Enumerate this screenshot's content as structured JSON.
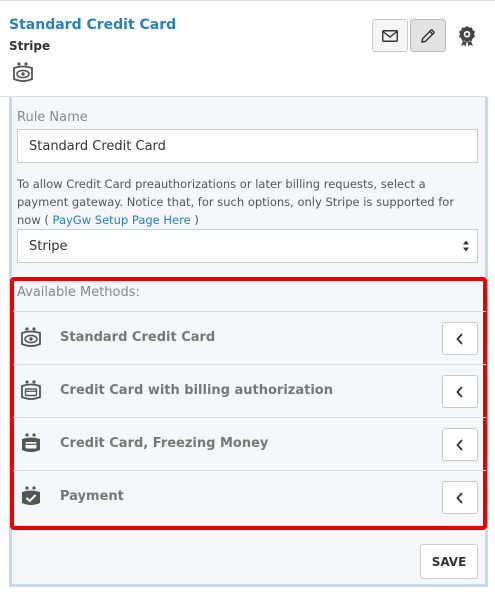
{
  "header": {
    "title": "Standard Credit Card",
    "subtitle": "Stripe",
    "icon": "eye-wallet-icon",
    "mail_icon": "envelope-icon",
    "edit_icon": "pencil-icon",
    "badge_icon": "award-badge-icon"
  },
  "form": {
    "rule_name_label": "Rule Name",
    "rule_name_value": "Standard Credit Card",
    "help_text": "To allow Credit Card preauthorizations or later billing requests, select a payment gateway. Notice that, for such options, only Stripe is supported for now ( ",
    "help_link": "PayGw Setup Page Here",
    "help_text_end": " )",
    "gateway_selected": "Stripe"
  },
  "methods": {
    "title": "Available Methods:",
    "items": [
      {
        "label": "Standard Credit Card",
        "icon": "eye-wallet-icon"
      },
      {
        "label": "Credit Card with billing authorization",
        "icon": "card-outline-wallet-icon"
      },
      {
        "label": "Credit Card, Freezing Money",
        "icon": "card-filled-wallet-icon"
      },
      {
        "label": "Payment",
        "icon": "check-wallet-icon"
      }
    ],
    "button_icon": "chevron-left-icon"
  },
  "actions": {
    "save_label": "SAVE"
  },
  "colors": {
    "link": "#2a7fc0",
    "highlight_border": "#ee0000",
    "panel_bg": "#f4f6f9",
    "panel_border": "#c6d9ec"
  }
}
